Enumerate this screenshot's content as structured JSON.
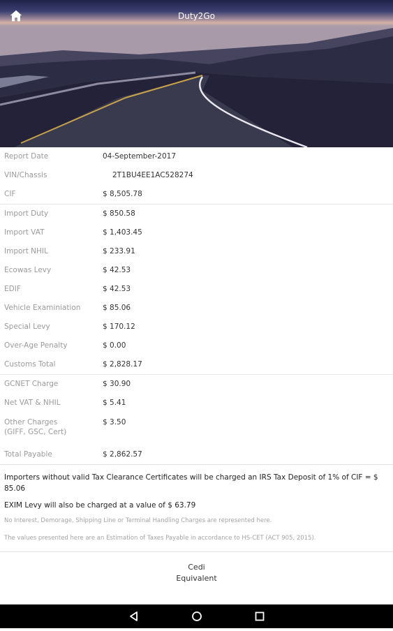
{
  "header": {
    "title": "Duty2Go",
    "home_icon": "home-icon"
  },
  "report": {
    "rows": [
      {
        "label": "Report Date",
        "value": "04-September-2017"
      },
      {
        "label": "VIN/Chassis",
        "value": "2T1BU4EE1AC528274"
      },
      {
        "label": "CIF",
        "value": "$ 8,505.78"
      }
    ],
    "duties": [
      {
        "label": "Import Duty",
        "value": "$ 850.58"
      },
      {
        "label": "Import VAT",
        "value": "$ 1,403.45"
      },
      {
        "label": "Import NHIL",
        "value": "$ 233.91"
      },
      {
        "label": "Ecowas Levy",
        "value": "$ 42.53"
      },
      {
        "label": "EDIF",
        "value": "$ 42.53"
      },
      {
        "label": "Vehicle Examiniation",
        "value": "$ 85.06"
      },
      {
        "label": "Special Levy",
        "value": "$ 170.12"
      },
      {
        "label": "Over-Age Penalty",
        "value": "$ 0.00"
      },
      {
        "label": "Customs Total",
        "value": "$ 2,828.17"
      }
    ],
    "charges": [
      {
        "label": "GCNET Charge",
        "value": "$ 30.90"
      },
      {
        "label": "Net VAT & NHIL",
        "value": "$ 5.41"
      },
      {
        "label": "Other Charges",
        "label2": "(GIFF, GSC, Cert)",
        "value": "$ 3.50"
      },
      {
        "label": "Total Payable",
        "value": "$ 2,862.57"
      }
    ]
  },
  "notes": {
    "irs": "Importers without valid Tax Clearance Certificates will be charged an IRS Tax Deposit of 1% of CIF = $ 85.06",
    "exim": "EXIM Levy will also be charged at a value of $ 63.79",
    "disclaimer1": "No Interest, Demorage, Shipping Line or  Terminal Handling Charges are represented here.",
    "disclaimer2": "The values presented here are an Estimation of Taxes Payable in accordance to HS-CET (ACT 905, 2015)."
  },
  "cedi_button": {
    "line1": "Cedi",
    "line2": "Equivalent"
  },
  "navbar": {
    "back_icon": "back-icon",
    "home_icon": "home-circle-icon",
    "recents_icon": "recents-icon"
  }
}
